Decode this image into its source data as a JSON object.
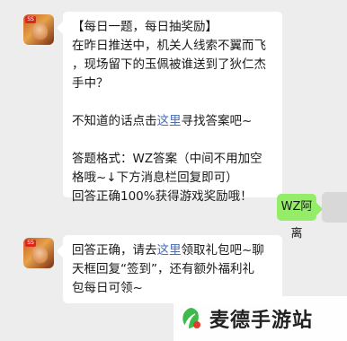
{
  "messages": [
    {
      "sender": "bot",
      "lines": [
        "【每日一题，每日抽奖励】",
        "在昨日推送中，机关人线索不翼而飞",
        "，现场留下的玉佩被谁送到了狄仁杰",
        "手中？"
      ],
      "hint_prefix": "不知道的话点击",
      "hint_link": "这里",
      "hint_suffix": "寻找答案吧~",
      "format_lines": [
        "答题格式：WZ答案（中间不用加空",
        "格哦~↓下方消息栏回复即可）",
        "回答正确100%获得游戏奖励哦！"
      ]
    },
    {
      "sender": "me",
      "text": "WZ阿离"
    },
    {
      "sender": "bot",
      "prefix": "回答正确，请去",
      "link": "这里",
      "suffix": "领取礼包吧~聊",
      "line2": "天框回复“签到”，还有额外福利礼",
      "line3": "包每日可领~"
    }
  ],
  "avatar_badge": "SS",
  "watermark": {
    "text": "麦德手游站",
    "logo_icon": "leaf-swirl-icon",
    "colors": {
      "green": "#3dbb4a",
      "red": "#e23b2e"
    }
  }
}
